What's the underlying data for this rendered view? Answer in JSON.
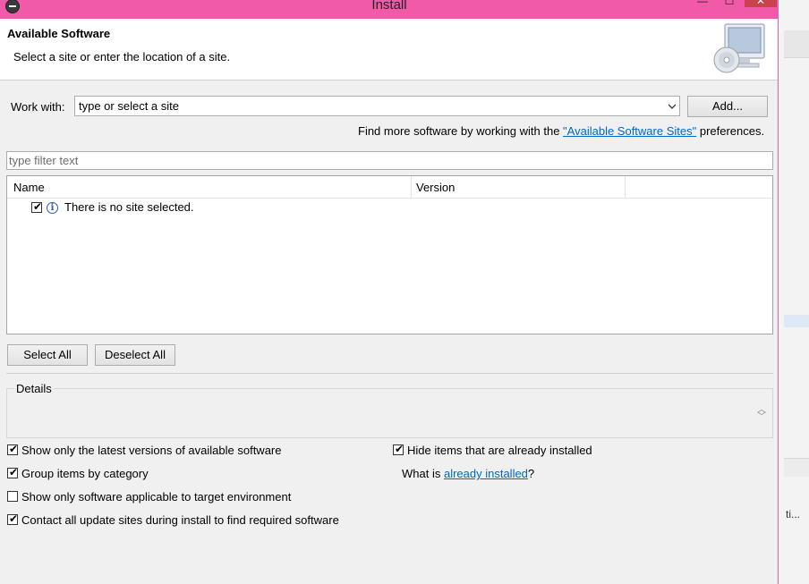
{
  "window": {
    "title": "Install",
    "min_glyph": "—",
    "max_glyph": "☐",
    "close_glyph": "✕"
  },
  "header": {
    "title": "Available Software",
    "description": "Select a site or enter the location of a site."
  },
  "work_with": {
    "label": "Work with:",
    "value": "type or select a site",
    "add_label": "Add..."
  },
  "find_more": {
    "prefix": "Find more software by working with the ",
    "link": "\"Available Software Sites\"",
    "suffix": " preferences."
  },
  "filter": {
    "placeholder": "type filter text"
  },
  "table": {
    "columns": [
      "Name",
      "Version"
    ],
    "rows": [
      {
        "checked": true,
        "icon": "info-icon",
        "text": "There is no site selected."
      }
    ]
  },
  "buttons": {
    "select_all": "Select All",
    "deselect_all": "Deselect All"
  },
  "details": {
    "label": "Details"
  },
  "options": [
    {
      "label": "Show only the latest versions of available software",
      "checked": true
    },
    {
      "label": "Group items by category",
      "checked": true
    },
    {
      "label": "Show only software applicable to target environment",
      "checked": false
    },
    {
      "label": "Contact all update sites during install to find required software",
      "checked": true
    },
    {
      "label": "Hide items that are already installed",
      "checked": true
    }
  ],
  "what_is": {
    "prefix": "What is ",
    "link": "already installed",
    "suffix": "?"
  },
  "background": {
    "truncated_text": "ti..."
  },
  "colors": {
    "frame": "#f05aa8",
    "link": "#0066cc",
    "close": "#c8434c"
  }
}
